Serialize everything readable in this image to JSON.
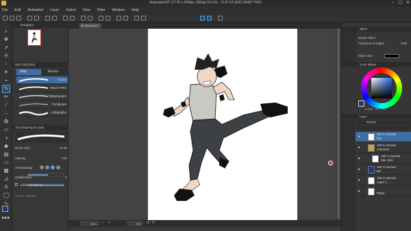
{
  "window": {
    "title": "Illustration53* (2776 x 4289px 300dpi 18.1%) - CLIP STUDIO PAINT PRO",
    "buttons": [
      "–",
      "▢",
      "✕"
    ]
  },
  "menu": [
    "File",
    "Edit",
    "Animation",
    "Layer",
    "Select",
    "View",
    "Filter",
    "Window",
    "Help"
  ],
  "navigator": {
    "title": "Navigator"
  },
  "subtool": {
    "title": "Sub Tool [Pen]",
    "tabs": [
      "Pen",
      "Marker"
    ],
    "brushes": [
      "G-pen",
      "Real G-Pen",
      "Mapping pen",
      "Turnip pen",
      "Calligraphy"
    ]
  },
  "tool_property": {
    "title": "Tool property [G-pen]",
    "brush_preview_name": "G-pen",
    "rows": [
      {
        "label": "Brush Size",
        "value": "10.35"
      },
      {
        "label": "Opacity",
        "value": "100"
      },
      {
        "label": "Anti-aliasing",
        "value": ""
      },
      {
        "label": "Stabilization",
        "value": "6"
      },
      {
        "label": "Adjust by speed",
        "value": ""
      },
      {
        "label": "Vector magnet",
        "value": ""
      }
    ]
  },
  "document": {
    "tab": "Illustration53*",
    "zoom": "18.1",
    "angle": "0.0"
  },
  "effect": {
    "title": "Effect",
    "border_effect": "Border effect",
    "thickness_label": "Thickness of edges",
    "thickness_value": "0.80",
    "edge_color_label": "Edge color"
  },
  "color_wheel": {
    "title": "Color Wheel",
    "h": "H 215",
    "s": "S 0",
    "v": "V 0"
  },
  "layers": {
    "title": "Layer",
    "blend": "Normal",
    "items": [
      {
        "pct": "100 % Normal",
        "name": "line"
      },
      {
        "pct": "100 % Normal",
        "name": "character"
      },
      {
        "pct": "100 % Normal",
        "name": "SW. SSH"
      },
      {
        "pct": "100 % Normal",
        "name": "BG"
      },
      {
        "pct": "100 % Normal",
        "name": "Layer 1"
      },
      {
        "pct": "",
        "name": "Paper"
      }
    ]
  },
  "colors": {
    "accent": "#3e6fa4",
    "highlight": "#4fa1e8",
    "canvas_bg": "#434343",
    "paper": "#ffffff",
    "main_color": "#1e3a7a"
  }
}
